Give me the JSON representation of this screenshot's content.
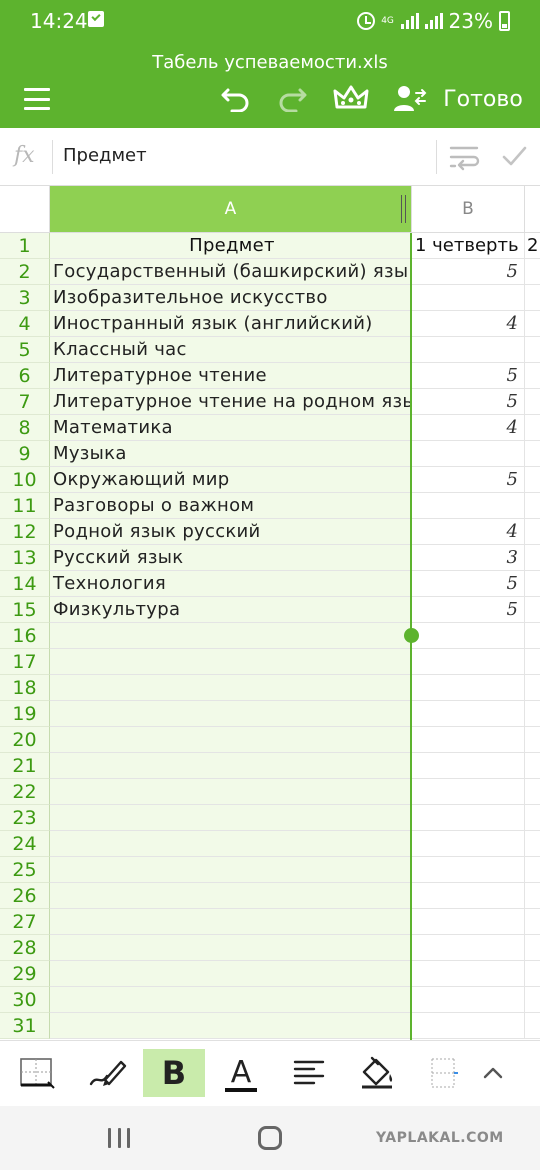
{
  "status_bar": {
    "time": "14:24",
    "network": "4G",
    "battery": "23%"
  },
  "app_bar": {
    "title": "Табель успеваемости.xls",
    "done_label": "Готово"
  },
  "formula_bar": {
    "fx_label": "fx",
    "value": "Предмет"
  },
  "sheet": {
    "columns": [
      "A",
      "B"
    ],
    "rows": [
      {
        "n": "1",
        "a": "Предмет",
        "b": "1 четверть",
        "c": "2"
      },
      {
        "n": "2",
        "a": "Государственный (башкирский) язык",
        "b": "5"
      },
      {
        "n": "3",
        "a": "Изобразительное искусство",
        "b": ""
      },
      {
        "n": "4",
        "a": "Иностранный язык (английский)",
        "b": "4"
      },
      {
        "n": "5",
        "a": "Классный час",
        "b": ""
      },
      {
        "n": "6",
        "a": "Литературное чтение",
        "b": "5"
      },
      {
        "n": "7",
        "a": "Литературное чтение на родном языке",
        "b": "5"
      },
      {
        "n": "8",
        "a": "Математика",
        "b": "4"
      },
      {
        "n": "9",
        "a": "Музыка",
        "b": ""
      },
      {
        "n": "10",
        "a": "Окружающий мир",
        "b": "5"
      },
      {
        "n": "11",
        "a": "Разговоры о важном",
        "b": ""
      },
      {
        "n": "12",
        "a": "Родной язык русский",
        "b": "4"
      },
      {
        "n": "13",
        "a": "Русский язык",
        "b": "3"
      },
      {
        "n": "14",
        "a": "Технология",
        "b": "5"
      },
      {
        "n": "15",
        "a": "Физкультура",
        "b": "5"
      },
      {
        "n": "16",
        "a": "",
        "b": ""
      },
      {
        "n": "17",
        "a": "",
        "b": ""
      },
      {
        "n": "18",
        "a": "",
        "b": ""
      },
      {
        "n": "19",
        "a": "",
        "b": ""
      },
      {
        "n": "20",
        "a": "",
        "b": ""
      },
      {
        "n": "21",
        "a": "",
        "b": ""
      },
      {
        "n": "22",
        "a": "",
        "b": ""
      },
      {
        "n": "23",
        "a": "",
        "b": ""
      },
      {
        "n": "24",
        "a": "",
        "b": ""
      },
      {
        "n": "25",
        "a": "",
        "b": ""
      },
      {
        "n": "26",
        "a": "",
        "b": ""
      },
      {
        "n": "27",
        "a": "",
        "b": ""
      },
      {
        "n": "28",
        "a": "",
        "b": ""
      },
      {
        "n": "29",
        "a": "",
        "b": ""
      },
      {
        "n": "30",
        "a": "",
        "b": ""
      },
      {
        "n": "31",
        "a": "",
        "b": ""
      }
    ]
  },
  "format_bar": {
    "bold_label": "B",
    "font_color_label": "A"
  },
  "watermark": "YAPLAKAL.COM",
  "colors": {
    "brand": "#5db32e",
    "selected_column": "#8fd052",
    "selected_fill": "#f2fae8",
    "row_number": "#3d9a12"
  },
  "icons": [
    "menu-icon",
    "undo-icon",
    "redo-icon",
    "crown-icon",
    "collaborators-icon",
    "wrap-text-icon",
    "check-icon",
    "borders-icon",
    "pen-icon",
    "fill-color-icon",
    "align-left-icon",
    "chevron-up-icon"
  ]
}
